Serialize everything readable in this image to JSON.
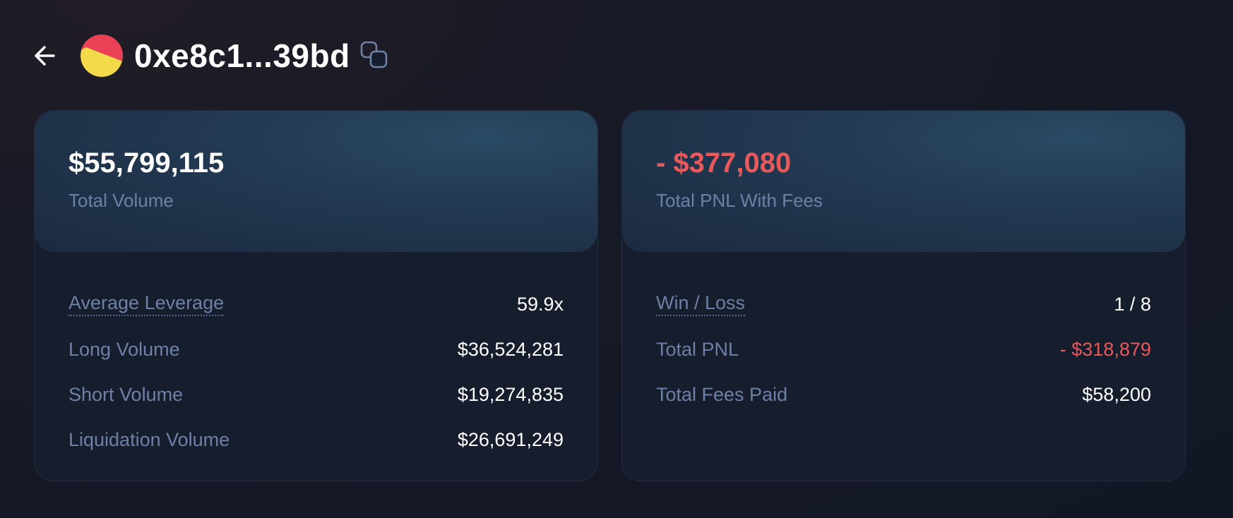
{
  "header": {
    "address": "0xe8c1...39bd"
  },
  "volume_card": {
    "total_value": "$55,799,115",
    "total_label": "Total Volume",
    "rows": [
      {
        "label": "Average Leverage",
        "value": "59.9x"
      },
      {
        "label": "Long Volume",
        "value": "$36,524,281"
      },
      {
        "label": "Short Volume",
        "value": "$19,274,835"
      },
      {
        "label": "Liquidation Volume",
        "value": "$26,691,249"
      }
    ]
  },
  "pnl_card": {
    "total_value": "- $377,080",
    "total_label": "Total PNL With Fees",
    "rows": [
      {
        "label": "Win / Loss",
        "value": "1 / 8"
      },
      {
        "label": "Total PNL",
        "value": "- $318,879"
      },
      {
        "label": "Total Fees Paid",
        "value": "$58,200"
      }
    ]
  },
  "colors": {
    "negative": "#e8595c",
    "label": "#6f80a6",
    "avatar_red": "#ea4156",
    "avatar_yellow": "#f2da4a"
  },
  "icons": {
    "back": "arrow-left-icon",
    "copy": "copy-icon"
  }
}
